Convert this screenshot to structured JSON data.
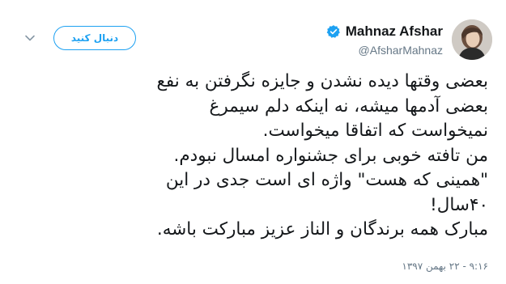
{
  "author": {
    "display_name": "Mahnaz Afshar",
    "handle": "@AfsharMahnaz",
    "verified": true,
    "avatar_icon": "profile-photo"
  },
  "actions": {
    "follow_label": "دنبال کنید",
    "menu_icon": "chevron-down-icon"
  },
  "tweet": {
    "lines": [
      "بعضی وقتها دیده نشدن و جایزه نگرفتن به نفع",
      "بعضی آدمها میشه، نه اینکه دلم سیمرغ",
      "نمیخواست که اتفاقا میخواست.",
      "من تافته خوبی برای جشنواره امسال نبودم.",
      "\"همینی که هست\" واژه ای است جدی در این",
      "۴۰سال!",
      "مبارک همه برندگان و الناز عزیز مبارکت باشه."
    ],
    "timestamp": "۹:۱۶ - ۲۲ بهمن ۱۳۹۷"
  },
  "colors": {
    "accent": "#1da1f2",
    "text": "#14171a",
    "muted": "#657786"
  }
}
